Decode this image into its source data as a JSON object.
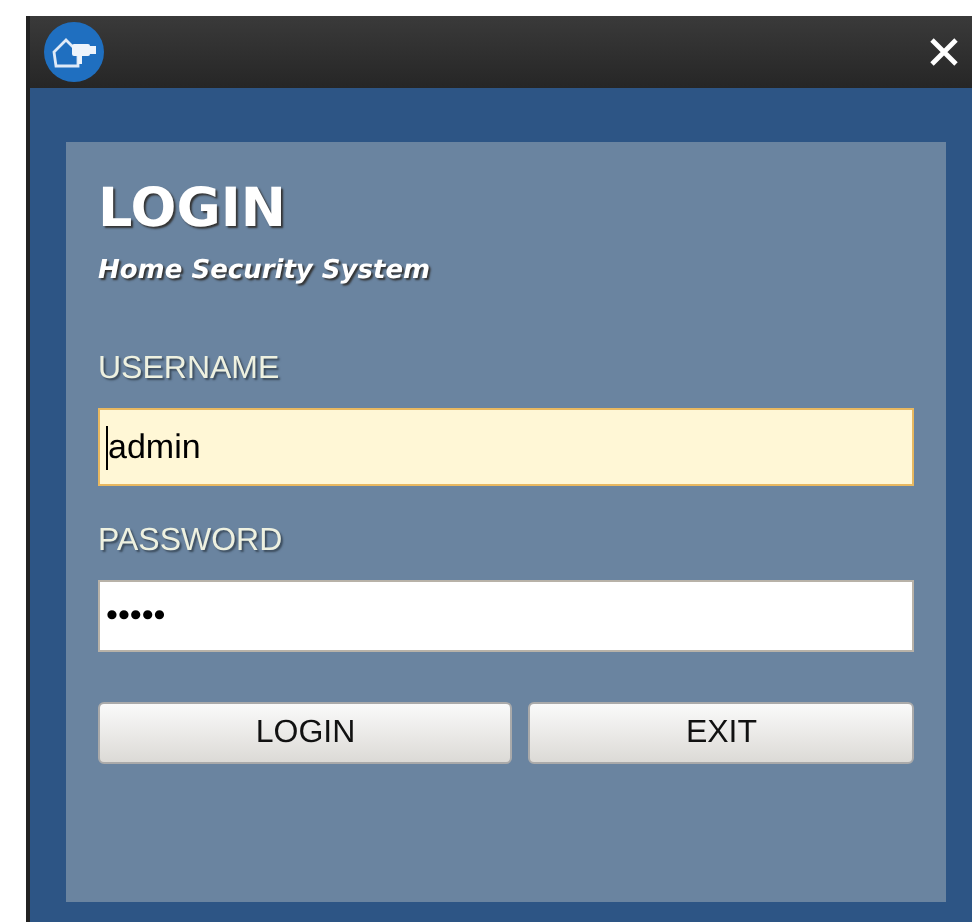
{
  "dialog": {
    "title": "LOGIN",
    "subtitle": "Home Security System"
  },
  "fields": [
    {
      "label": "USERNAME",
      "value": "admin",
      "focused": true
    },
    {
      "label": "PASSWORD",
      "value": "•••••",
      "focused": false
    }
  ],
  "buttons": [
    "LOGIN",
    "EXIT"
  ]
}
